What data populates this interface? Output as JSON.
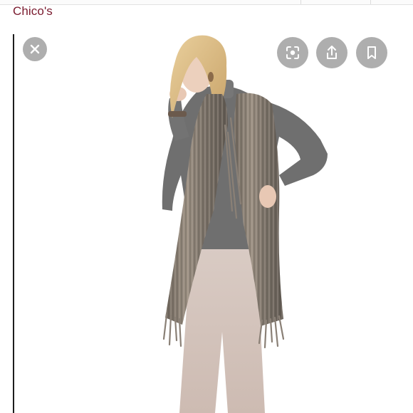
{
  "header": {
    "brand": "Chico's"
  },
  "viewer": {
    "photo_subject": "product-photo",
    "actions": {
      "close_icon": "close-icon",
      "lens_icon": "lens-icon",
      "share_icon": "share-icon",
      "bookmark_icon": "bookmark-icon"
    }
  },
  "colors": {
    "brand_text": "#7a1a2e",
    "action_button_bg": "#a8a8a8",
    "frame_line": "#1c1c1c"
  }
}
